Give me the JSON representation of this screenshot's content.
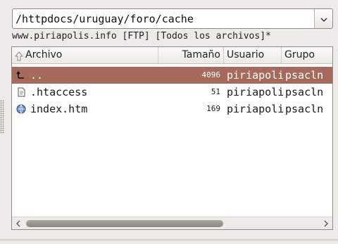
{
  "path_bar": {
    "path": "/httpdocs/uruguay/foro/cache",
    "dropdown_icon": "chevron-down-icon"
  },
  "location_line": "www.piriapolis.info [FTP] [Todos los archivos]*",
  "columns": {
    "name": "Archivo",
    "size": "Tamaño",
    "user": "Usuario",
    "group": "Grupo"
  },
  "files": [
    {
      "icon": "parent-folder-icon",
      "name": "..",
      "size": "4096",
      "user": "piriapolis",
      "group": "psacln",
      "selected": true
    },
    {
      "icon": "text-file-icon",
      "name": ".htaccess",
      "size": "51",
      "user": "piriapolis",
      "group": "psacln",
      "selected": false
    },
    {
      "icon": "html-file-icon",
      "name": "index.htm",
      "size": "169",
      "user": "piriapolis",
      "group": "psacln",
      "selected": false
    }
  ],
  "colors": {
    "selection": "#a66a5c",
    "background": "#edebe7"
  }
}
